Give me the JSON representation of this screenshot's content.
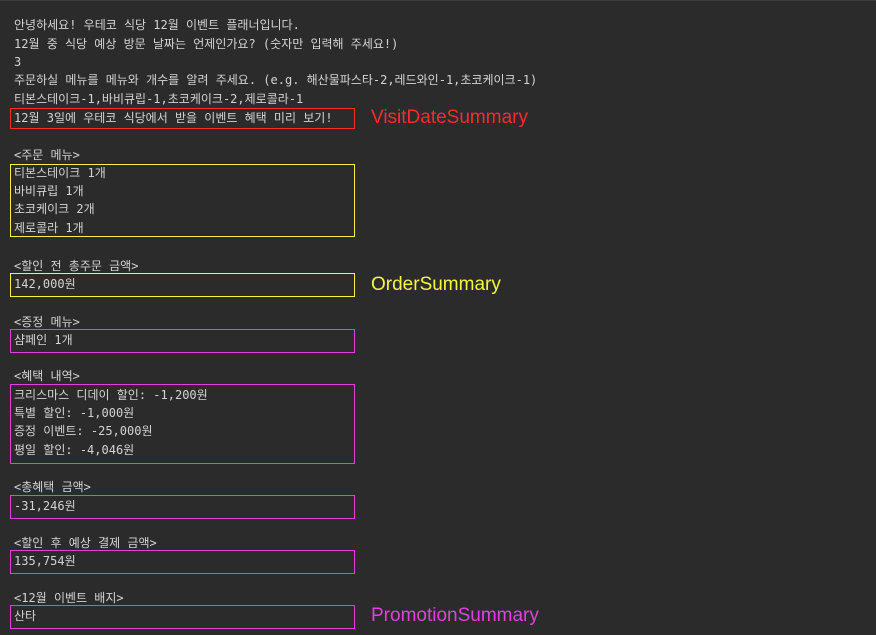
{
  "colors": {
    "background": "#2b2b2b",
    "text": "#d4d4d4",
    "visit_box": "#ff2a2a",
    "order_box": "#f5f542",
    "promotion_box": "#e040e0"
  },
  "console": {
    "greeting": "안녕하세요! 우테코 식당 12월 이벤트 플래너입니다.",
    "date_prompt": "12월 중 식당 예상 방문 날짜는 언제인가요? (숫자만 입력해 주세요!)",
    "date_input": "3",
    "menu_prompt": "주문하실 메뉴를 메뉴와 개수를 알려 주세요. (e.g. 해산물파스타-2,레드와인-1,초코케이크-1)",
    "menu_input": "티본스테이크-1,바비큐립-1,초코케이크-2,제로콜라-1",
    "preview_line": "12월 3일에 우테코 식당에서 받을 이벤트 혜택 미리 보기!",
    "order_menu": {
      "header": "<주문 메뉴>",
      "items": [
        "티본스테이크 1개",
        "바비큐립 1개",
        "초코케이크 2개",
        "제로콜라 1개"
      ]
    },
    "total_before": {
      "header": "<할인 전 총주문 금액>",
      "value": "142,000원"
    },
    "gift_menu": {
      "header": "<증정 메뉴>",
      "value": "샴페인 1개"
    },
    "benefits": {
      "header": "<혜택 내역>",
      "items": [
        "크리스마스 디데이 할인: -1,200원",
        "특별 할인: -1,000원",
        "증정 이벤트: -25,000원",
        "평일 할인: -4,046원"
      ]
    },
    "total_benefit": {
      "header": "<총혜택 금액>",
      "value": "-31,246원"
    },
    "payment": {
      "header": "<할인 후 예상 결제 금액>",
      "value": "135,754원"
    },
    "badge": {
      "header": "<12월 이벤트 배지>",
      "value": "산타"
    }
  },
  "annotations": {
    "visit": "VisitDateSummary",
    "order": "OrderSummary",
    "promotion": "PromotionSummary"
  }
}
